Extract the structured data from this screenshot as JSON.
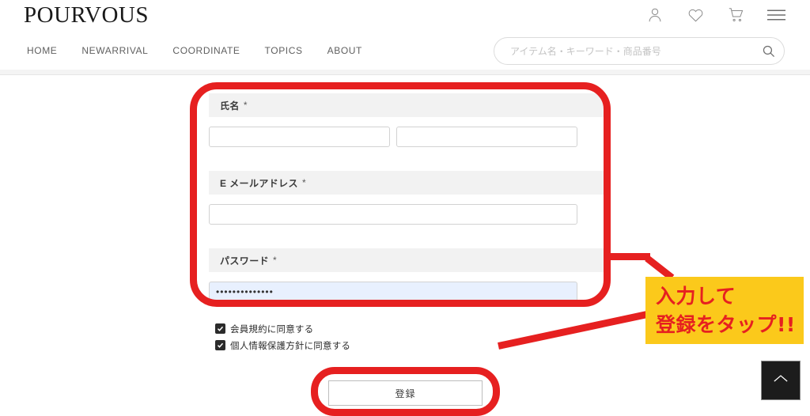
{
  "site": {
    "logo": "POURVOUS"
  },
  "nav": {
    "items": [
      {
        "label": "HOME"
      },
      {
        "label": "NEWARRIVAL"
      },
      {
        "label": "COORDINATE"
      },
      {
        "label": "TOPICS"
      },
      {
        "label": "ABOUT"
      }
    ]
  },
  "header_icons": [
    {
      "name": "account-icon"
    },
    {
      "name": "wishlist-heart-icon"
    },
    {
      "name": "cart-icon"
    },
    {
      "name": "hamburger-menu-icon"
    }
  ],
  "search": {
    "placeholder": "アイテム名・キーワード・商品番号",
    "value": "",
    "icon": "search-icon"
  },
  "form": {
    "fields": [
      {
        "label": "氏名",
        "required_mark": "*",
        "inputs": [
          {
            "value": "",
            "placeholder": "",
            "type": "text"
          },
          {
            "value": "",
            "placeholder": "",
            "type": "text"
          }
        ]
      },
      {
        "label": "E メールアドレス",
        "required_mark": "*",
        "inputs": [
          {
            "value": "",
            "placeholder": "",
            "type": "email"
          }
        ]
      },
      {
        "label": "パスワード",
        "required_mark": "*",
        "inputs": [
          {
            "value": "••••••••••••••",
            "placeholder": "",
            "type": "password"
          }
        ]
      }
    ],
    "checkboxes": [
      {
        "label": "会員規約に同意する",
        "checked": true
      },
      {
        "label": "個人情報保護方針に同意する",
        "checked": true
      }
    ],
    "submit_label": "登録"
  },
  "annotations": {
    "callout_line1": "入力して",
    "callout_line2": "登録をタップ!!",
    "highlight_color": "#e62020",
    "callout_bg": "#fbc91b",
    "callout_text_color": "#e62020"
  },
  "scroll_top": {
    "icon": "chevron-up-icon"
  }
}
